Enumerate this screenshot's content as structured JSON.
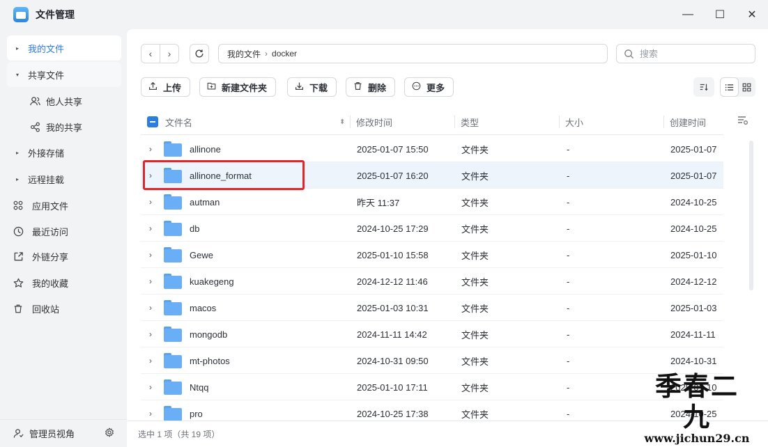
{
  "window": {
    "title": "文件管理",
    "minimize_glyph": "—",
    "maximize_glyph": "☐",
    "close_glyph": "✕"
  },
  "sidebar": {
    "items": [
      {
        "label": "我的文件",
        "icon": "caret-right-icon",
        "active": true
      },
      {
        "label": "共享文件",
        "icon": "caret-down-icon",
        "active": false
      },
      {
        "label": "他人共享",
        "icon": "users-icon",
        "sub": true
      },
      {
        "label": "我的共享",
        "icon": "share-icon",
        "sub": true
      },
      {
        "label": "外接存储",
        "icon": "caret-right-icon"
      },
      {
        "label": "远程挂载",
        "icon": "caret-right-icon"
      },
      {
        "label": "应用文件",
        "icon": "apps-icon"
      },
      {
        "label": "最近访问",
        "icon": "clock-icon"
      },
      {
        "label": "外链分享",
        "icon": "external-link-icon"
      },
      {
        "label": "我的收藏",
        "icon": "star-icon"
      },
      {
        "label": "回收站",
        "icon": "trash-icon"
      }
    ],
    "footer_label": "管理员视角"
  },
  "address": {
    "root": "我的文件",
    "separator": "›",
    "current": "docker"
  },
  "search": {
    "placeholder": "搜索"
  },
  "toolbar": {
    "upload": "上传",
    "new_folder": "新建文件夹",
    "download": "下载",
    "delete": "删除",
    "more": "更多"
  },
  "table": {
    "headers": {
      "name": "文件名",
      "modified": "修改时间",
      "type": "类型",
      "size": "大小",
      "created": "创建时间"
    },
    "rows": [
      {
        "name": "allinone",
        "modified": "2025-01-07 15:50",
        "type": "文件夹",
        "size": "-",
        "created": "2025-01-07"
      },
      {
        "name": "allinone_format",
        "modified": "2025-01-07 16:20",
        "type": "文件夹",
        "size": "-",
        "created": "2025-01-07",
        "selected": true
      },
      {
        "name": "autman",
        "modified": "昨天 11:37",
        "type": "文件夹",
        "size": "-",
        "created": "2024-10-25"
      },
      {
        "name": "db",
        "modified": "2024-10-25 17:29",
        "type": "文件夹",
        "size": "-",
        "created": "2024-10-25"
      },
      {
        "name": "Gewe",
        "modified": "2025-01-10 15:58",
        "type": "文件夹",
        "size": "-",
        "created": "2025-01-10"
      },
      {
        "name": "kuakegeng",
        "modified": "2024-12-12 11:46",
        "type": "文件夹",
        "size": "-",
        "created": "2024-12-12"
      },
      {
        "name": "macos",
        "modified": "2025-01-03 10:31",
        "type": "文件夹",
        "size": "-",
        "created": "2025-01-03"
      },
      {
        "name": "mongodb",
        "modified": "2024-11-11 14:42",
        "type": "文件夹",
        "size": "-",
        "created": "2024-11-11"
      },
      {
        "name": "mt-photos",
        "modified": "2024-10-31 09:50",
        "type": "文件夹",
        "size": "-",
        "created": "2024-10-31"
      },
      {
        "name": "Ntqq",
        "modified": "2025-01-10 17:11",
        "type": "文件夹",
        "size": "-",
        "created": "2025-01-10"
      },
      {
        "name": "pro",
        "modified": "2024-10-25 17:38",
        "type": "文件夹",
        "size": "-",
        "created": "2024-10-25"
      }
    ]
  },
  "status": {
    "text": "选中 1 项（共 19 项）"
  },
  "watermark": {
    "big": "季春二九",
    "small": "www.jichun29.cn"
  },
  "colors": {
    "accent": "#2b7de0",
    "highlight_border": "#e0262a",
    "folder": "#6aaef5",
    "selected_row": "#eef4fc"
  }
}
